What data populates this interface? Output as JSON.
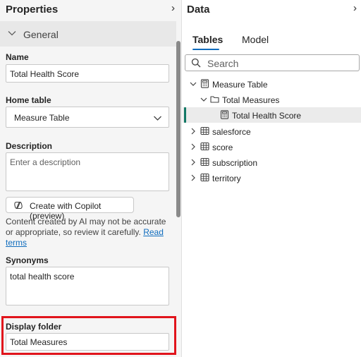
{
  "properties": {
    "title": "Properties",
    "section": "General",
    "name": {
      "label": "Name",
      "value": "Total Health Score"
    },
    "home_table": {
      "label": "Home table",
      "value": "Measure Table"
    },
    "description": {
      "label": "Description",
      "placeholder": "Enter a description"
    },
    "copilot_button": "Create with Copilot (preview)",
    "disclaimer": "Content created by AI may not be accurate or appropriate, so review it carefully.",
    "read_terms": "Read terms",
    "synonyms": {
      "label": "Synonyms",
      "value": "total health score"
    },
    "display_folder": {
      "label": "Display folder",
      "value": "Total Measures"
    }
  },
  "data_pane": {
    "title": "Data",
    "tabs": [
      "Tables",
      "Model"
    ],
    "search_placeholder": "Search",
    "tree": {
      "measure_table": "Measure Table",
      "folder": "Total Measures",
      "measure": "Total Health Score",
      "tables": [
        "salesforce",
        "score",
        "subscription",
        "territory"
      ]
    }
  },
  "colors": {
    "accent": "#0f6cbd",
    "selection_bar": "#117865",
    "highlight": "#e1141c"
  }
}
